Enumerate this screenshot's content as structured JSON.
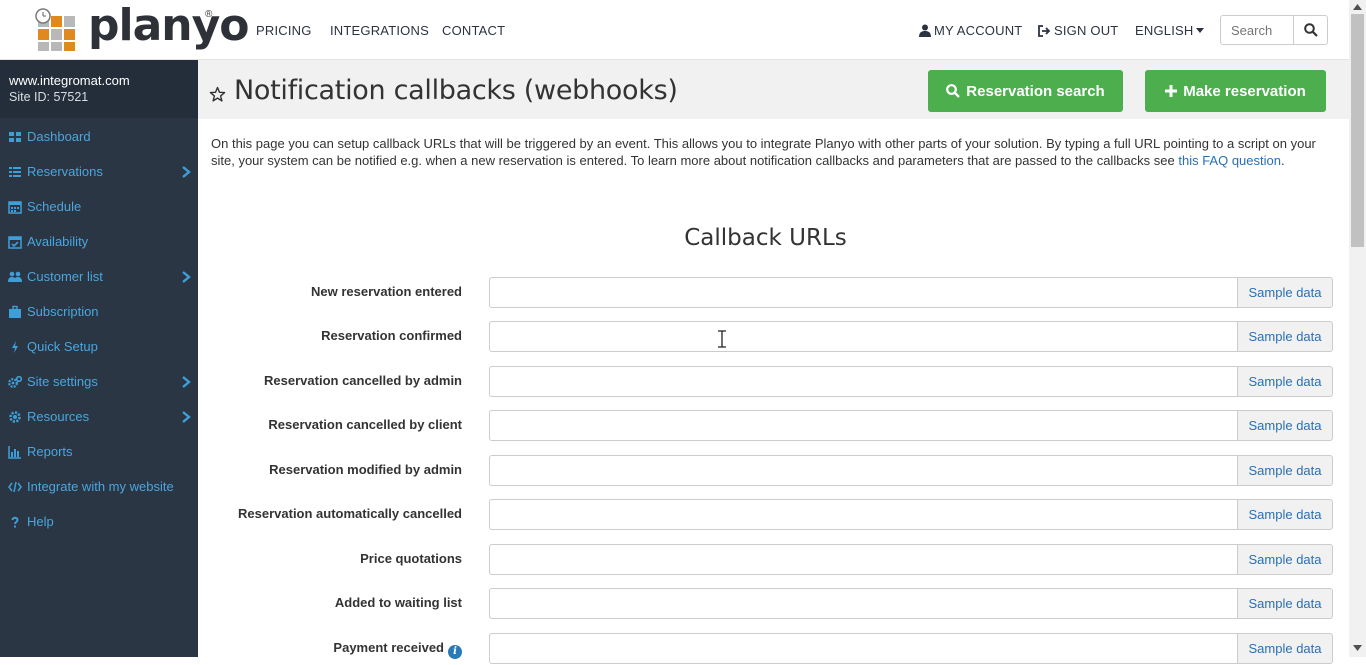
{
  "brand": {
    "name": "planyo",
    "registered": "®",
    "colors": {
      "accent": "#4cae4c",
      "sidebar": "#2a3644",
      "link": "#2a6fb6",
      "sidebar_link": "#4aa6de"
    }
  },
  "top_nav": {
    "links": [
      "PRICING",
      "INTEGRATIONS",
      "CONTACT"
    ],
    "my_account": "MY ACCOUNT",
    "sign_out": "SIGN OUT",
    "language": "ENGLISH",
    "search_placeholder": "Search"
  },
  "sidebar": {
    "site_domain": "www.integromat.com",
    "site_id": "Site ID: 57521",
    "items": [
      {
        "label": "Dashboard",
        "icon": "dashboard-icon",
        "has_submenu": false
      },
      {
        "label": "Reservations",
        "icon": "list-icon",
        "has_submenu": true
      },
      {
        "label": "Schedule",
        "icon": "calendar-icon",
        "has_submenu": false
      },
      {
        "label": "Availability",
        "icon": "calendar-check-icon",
        "has_submenu": false
      },
      {
        "label": "Customer list",
        "icon": "users-icon",
        "has_submenu": true
      },
      {
        "label": "Subscription",
        "icon": "briefcase-icon",
        "has_submenu": false
      },
      {
        "label": "Quick Setup",
        "icon": "bolt-icon",
        "has_submenu": false
      },
      {
        "label": "Site settings",
        "icon": "cogs-icon",
        "has_submenu": true
      },
      {
        "label": "Resources",
        "icon": "gear-icon",
        "has_submenu": true
      },
      {
        "label": "Reports",
        "icon": "bar-chart-icon",
        "has_submenu": false
      },
      {
        "label": "Integrate with my website",
        "icon": "code-icon",
        "has_submenu": false
      },
      {
        "label": "Help",
        "icon": "question-icon",
        "has_submenu": false
      }
    ]
  },
  "header": {
    "title": "Notification callbacks (webhooks)",
    "reservation_search": "Reservation search",
    "make_reservation": "Make reservation"
  },
  "intro": {
    "text": "On this page you can setup callback URLs that will be triggered by an event. This allows you to integrate Planyo with other parts of your solution. By typing a full URL pointing to a script on your site, your system can be notified e.g. when a new reservation is entered. To learn more about notification callbacks and parameters that are passed to the callbacks see ",
    "link_text": "this FAQ question",
    "end": "."
  },
  "callbacks": {
    "section_title": "Callback URLs",
    "sample_label": "Sample data",
    "rows": [
      {
        "label": "New reservation entered",
        "value": ""
      },
      {
        "label": "Reservation confirmed",
        "value": ""
      },
      {
        "label": "Reservation cancelled by admin",
        "value": ""
      },
      {
        "label": "Reservation cancelled by client",
        "value": ""
      },
      {
        "label": "Reservation modified by admin",
        "value": ""
      },
      {
        "label": "Reservation automatically cancelled",
        "value": ""
      },
      {
        "label": "Price quotations",
        "value": ""
      },
      {
        "label": "Added to waiting list",
        "value": ""
      },
      {
        "label": "Payment received",
        "value": "",
        "info": true
      }
    ]
  }
}
